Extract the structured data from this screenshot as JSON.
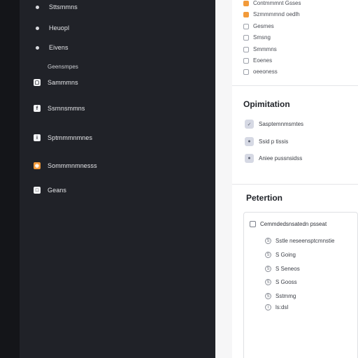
{
  "sidebar": {
    "items": [
      {
        "label": "Sttsmmns",
        "icon": "bullet-icon"
      },
      {
        "label": "Heuopl",
        "icon": "bullet-icon"
      },
      {
        "label": "Eivens",
        "icon": "bullet-icon"
      },
      {
        "label": "Geensmpes",
        "icon": "none"
      },
      {
        "label": "Sammmns",
        "icon": "document-icon"
      },
      {
        "label": "Ssrnnsmmns",
        "icon": "facebook-icon"
      },
      {
        "label": "Sptmmmnmnes",
        "icon": "info-icon"
      },
      {
        "label": "Sommmnmnesss",
        "icon": "rss-icon"
      },
      {
        "label": "Geans",
        "icon": "square-icon"
      }
    ]
  },
  "panel": {
    "top_list": [
      {
        "label": "Contmmmnt Gsses",
        "checked": true
      },
      {
        "label": "Szmmmmnd oedlh",
        "checked": true
      },
      {
        "label": "Gesmes",
        "checked": false
      },
      {
        "label": "Smsng",
        "checked": false
      },
      {
        "label": "Smmmns",
        "checked": false
      },
      {
        "label": "Eoenes",
        "checked": false
      },
      {
        "label": "oeeoness",
        "checked": false
      }
    ],
    "optimization": {
      "title": "Opimitation",
      "items": [
        {
          "label": "Sasptemnmsmtes",
          "icon": "check-icon"
        },
        {
          "label": "Ssid p tissis",
          "icon": "dot-icon"
        },
        {
          "label": "Aniee pussnsidss",
          "icon": "dot-icon"
        }
      ]
    },
    "petertion": {
      "title": "Petertion",
      "card": {
        "header": "Cemmdedsnsatedn psseat",
        "rows": [
          "Sstle neseensptcmnstie",
          "S Going",
          "S Seneos",
          "S Gooss",
          "Sstmmg",
          "ls:dsl"
        ]
      }
    }
  },
  "colors": {
    "sidebar_bg": "#202228",
    "accent_orange": "#f29a3a",
    "panel_bg": "#ffffff"
  }
}
